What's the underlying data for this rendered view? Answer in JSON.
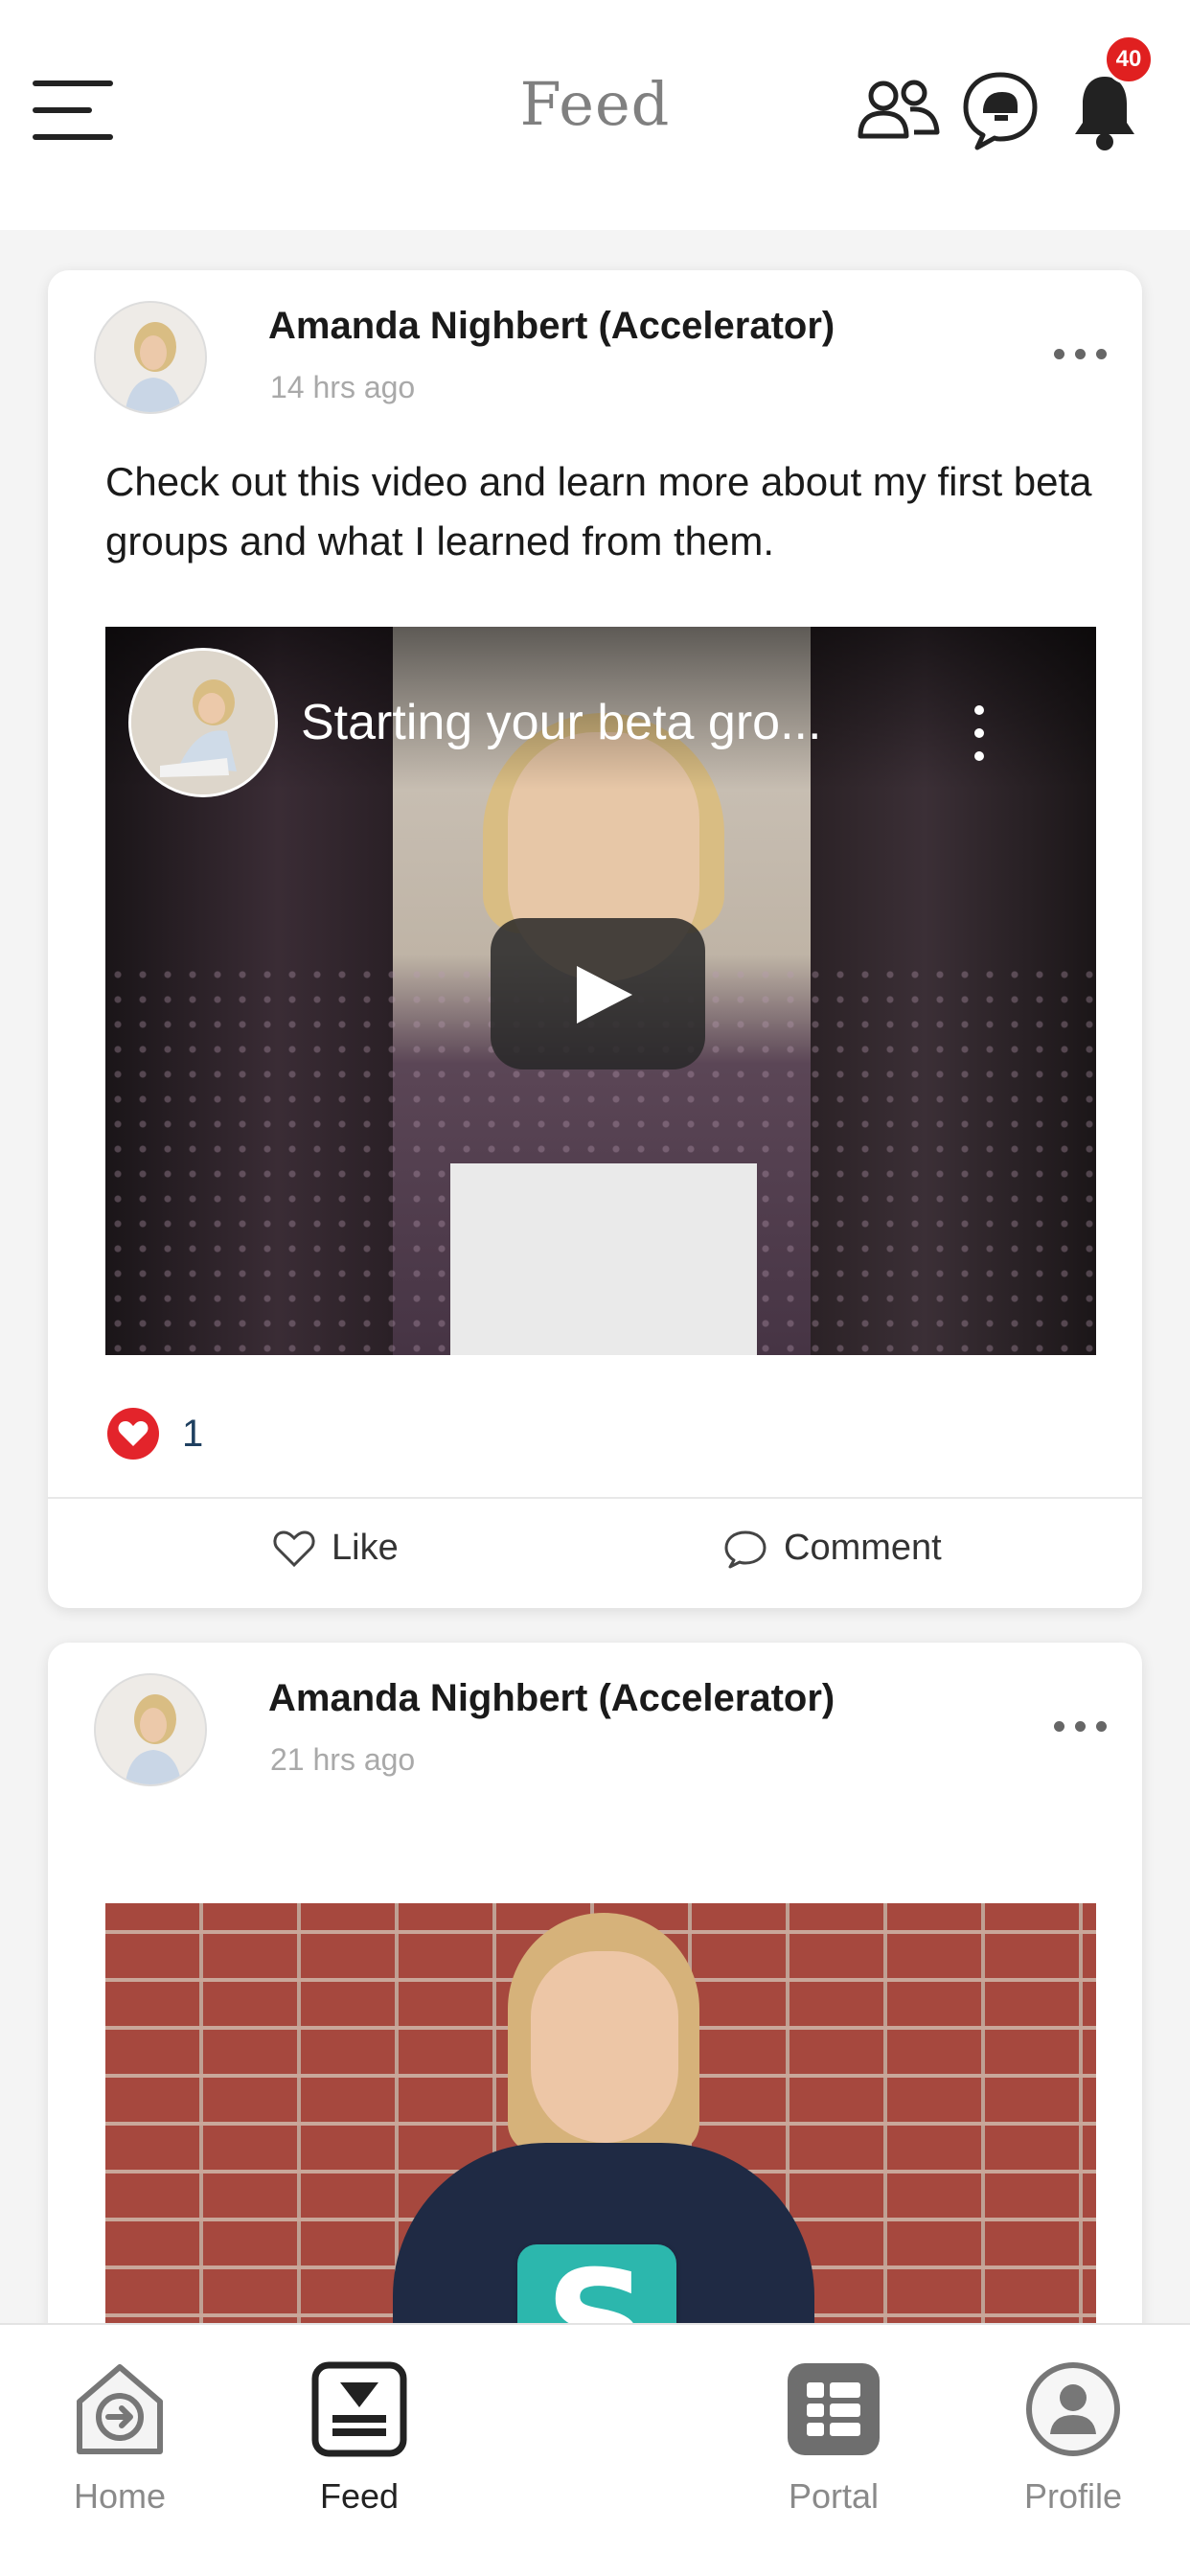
{
  "header": {
    "title": "Feed",
    "notification_count": "40"
  },
  "posts": [
    {
      "author": "Amanda Nighbert (Accelerator)",
      "time": "14 hrs ago",
      "text": "Check out this video and learn more about my first beta groups and what I learned from them.",
      "video_title": "Starting your beta gro...",
      "like_count": "1",
      "actions": {
        "like": "Like",
        "comment": "Comment"
      }
    },
    {
      "author": "Amanda Nighbert (Accelerator)",
      "time": "21 hrs ago"
    }
  ],
  "bottom_nav": {
    "items": [
      {
        "label": "Home",
        "icon": "home-arrow-icon"
      },
      {
        "label": "Feed",
        "icon": "feed-tray-icon",
        "active": true
      },
      {
        "label": "Portal",
        "icon": "portal-grid-icon"
      },
      {
        "label": "Profile",
        "icon": "profile-icon"
      }
    ],
    "center_logo_letter": "S"
  },
  "colors": {
    "badge": "#e02020",
    "heart": "#e3242b",
    "logo": "#2cb7ad",
    "title": "#808080"
  }
}
